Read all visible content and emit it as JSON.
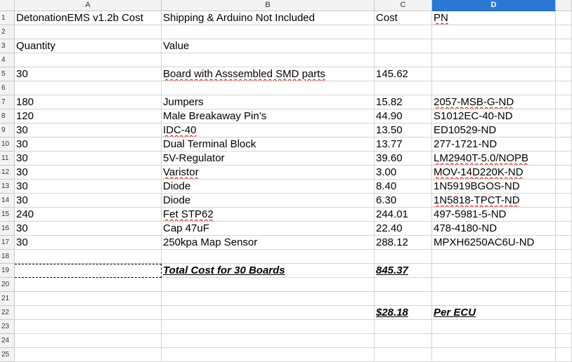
{
  "columns": [
    "A",
    "B",
    "C",
    "D"
  ],
  "selected_column": "D",
  "rows": [
    {
      "n": "1",
      "a": "DetonationEMS v1.2b Cost",
      "b": "Shipping & Arduino Not Included",
      "c": "Cost",
      "d": "PN"
    },
    {
      "n": "2",
      "a": "",
      "b": "",
      "c": "",
      "d": ""
    },
    {
      "n": "3",
      "a": "Quantity",
      "b": "Value",
      "c": "",
      "d": ""
    },
    {
      "n": "4",
      "a": "",
      "b": "",
      "c": "",
      "d": ""
    },
    {
      "n": "5",
      "a": "30",
      "b": "Board with Asssembled SMD parts",
      "c": "145.62",
      "d": ""
    },
    {
      "n": "6",
      "a": "",
      "b": "",
      "c": "",
      "d": ""
    },
    {
      "n": "7",
      "a": "180",
      "b": "Jumpers",
      "c": "15.82",
      "d": "2057-MSB-G-ND"
    },
    {
      "n": "8",
      "a": "120",
      "b": "Male Breakaway Pin’s",
      "c": "44.90",
      "d": "S1012EC-40-ND"
    },
    {
      "n": "9",
      "a": "30",
      "b": "IDC-40",
      "c": "13.50",
      "d": "ED10529-ND"
    },
    {
      "n": "10",
      "a": "30",
      "b": "Dual Terminal Block",
      "c": "13.77",
      "d": "277-1721-ND"
    },
    {
      "n": "11",
      "a": "30",
      "b": "5V-Regulator",
      "c": "39.60",
      "d": "LM2940T-5.0/NOPB"
    },
    {
      "n": "12",
      "a": "30",
      "b": "Varistor",
      "c": "3.00",
      "d": "MOV-14D220K-ND"
    },
    {
      "n": "13",
      "a": "30",
      "b": "Diode",
      "c": "8.40",
      "d": "1N5919BGOS-ND"
    },
    {
      "n": "14",
      "a": "30",
      "b": "Diode",
      "c": "6.30",
      "d": "1N5818-TPCT-ND"
    },
    {
      "n": "15",
      "a": "240",
      "b": "Fet STP62",
      "c": "244.01",
      "d": "497-5981-5-ND"
    },
    {
      "n": "16",
      "a": "30",
      "b": "Cap 47uF",
      "c": "22.40",
      "d": "478-4180-ND"
    },
    {
      "n": "17",
      "a": "30",
      "b": "250kpa Map Sensor",
      "c": "288.12",
      "d": "MPXH6250AC6U-ND"
    },
    {
      "n": "18",
      "a": "",
      "b": "",
      "c": "",
      "d": ""
    },
    {
      "n": "19",
      "a": "",
      "b": "Total Cost for 30 Boards",
      "c": "845.37",
      "d": ""
    },
    {
      "n": "20",
      "a": "",
      "b": "",
      "c": "",
      "d": ""
    },
    {
      "n": "21",
      "a": "",
      "b": "",
      "c": "",
      "d": ""
    },
    {
      "n": "22",
      "a": "",
      "b": "",
      "c": "$28.18",
      "d": "Per ECU"
    },
    {
      "n": "23",
      "a": "",
      "b": "",
      "c": "",
      "d": ""
    },
    {
      "n": "24",
      "a": "",
      "b": "",
      "c": "",
      "d": ""
    },
    {
      "n": "25",
      "a": "",
      "b": "",
      "c": "",
      "d": ""
    }
  ],
  "colors": {
    "header_bg": "#f3f3f3",
    "selected_header": "#2a78d4",
    "grid": "#d4d4d4",
    "spell_error": "#d00000"
  }
}
